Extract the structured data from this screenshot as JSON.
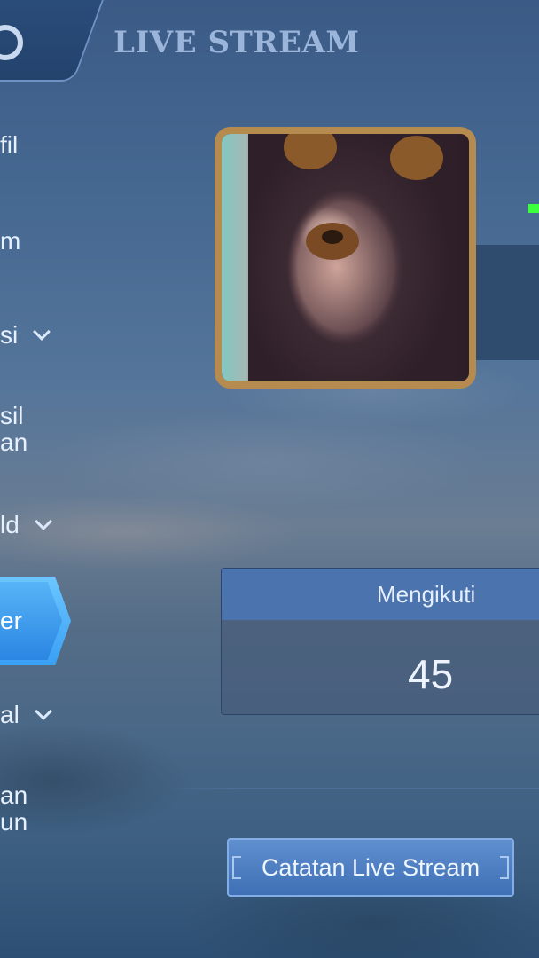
{
  "header": {
    "title": "LIVE STREAM",
    "back_icon": "back-ring-icon"
  },
  "sidebar": {
    "items": [
      {
        "label": "fil",
        "chevron": false
      },
      {
        "label": "m",
        "chevron": false
      },
      {
        "label": "si",
        "chevron": true
      },
      {
        "label_line1": "sil",
        "label_line2": "an",
        "chevron": false
      },
      {
        "label": "ld",
        "chevron": true
      },
      {
        "label": "er",
        "active": true
      },
      {
        "label": "al",
        "chevron": true
      },
      {
        "label_line1": "an",
        "label_line2": "un",
        "chevron": false
      }
    ]
  },
  "profile": {
    "avatar_frame_color": "#b58b4f"
  },
  "stats": {
    "label": "Mengikuti",
    "value": "45"
  },
  "buttons": {
    "record_label": "Catatan Live Stream"
  },
  "colors": {
    "accent": "#4b73ad",
    "active_tab": "#3aa0f5"
  }
}
